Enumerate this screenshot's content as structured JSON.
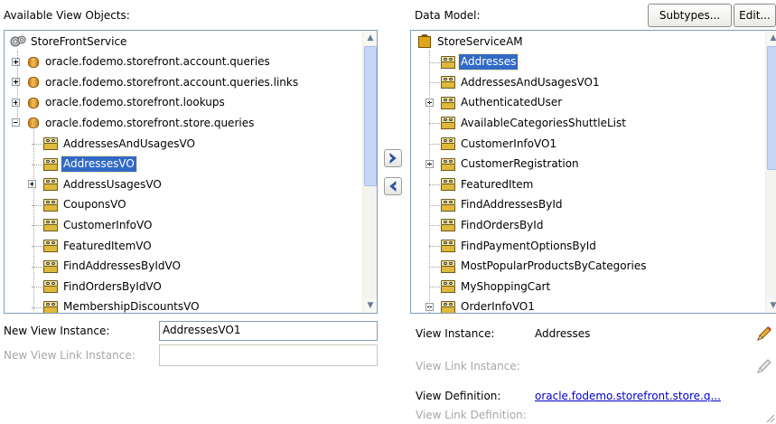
{
  "left": {
    "header": "Available View Objects:",
    "tree": [
      {
        "label": "StoreFrontService",
        "kind": "service",
        "level": 0
      },
      {
        "label": "oracle.fodemo.storefront.account.queries",
        "kind": "package",
        "level": 1,
        "expander": "plus"
      },
      {
        "label": "oracle.fodemo.storefront.account.queries.links",
        "kind": "package",
        "level": 1,
        "expander": "plus"
      },
      {
        "label": "oracle.fodemo.storefront.lookups",
        "kind": "package",
        "level": 1,
        "expander": "plus"
      },
      {
        "label": "oracle.fodemo.storefront.store.queries",
        "kind": "package",
        "level": 1,
        "expander": "minus"
      },
      {
        "label": "AddressesAndUsagesVO",
        "kind": "vo",
        "level": 2
      },
      {
        "label": "AddressesVO",
        "kind": "vo",
        "level": 2,
        "selected": true
      },
      {
        "label": "AddressUsagesVO",
        "kind": "vo",
        "level": 2,
        "expander": "plus"
      },
      {
        "label": "CouponsVO",
        "kind": "vo",
        "level": 2
      },
      {
        "label": "CustomerInfoVO",
        "kind": "vo",
        "level": 2
      },
      {
        "label": "FeaturedItemVO",
        "kind": "vo",
        "level": 2
      },
      {
        "label": "FindAddressesByIdVO",
        "kind": "vo",
        "level": 2
      },
      {
        "label": "FindOrdersByIdVO",
        "kind": "vo",
        "level": 2
      },
      {
        "label": "MembershipDiscountsVO",
        "kind": "vo",
        "level": 2
      }
    ],
    "new_view_instance_label": "New View Instance:",
    "new_view_instance_value": "AddressesVO1",
    "new_view_link_instance_label": "New View Link Instance:",
    "new_view_link_instance_value": ""
  },
  "shuttle": {
    "add_icon": "chevron-right-icon",
    "remove_icon": "chevron-left-icon"
  },
  "right": {
    "header": "Data Model:",
    "subtypes_button": "Subtypes...",
    "edit_button": "Edit...",
    "tree": [
      {
        "label": "StoreServiceAM",
        "kind": "am",
        "level": 0
      },
      {
        "label": "Addresses",
        "kind": "vo",
        "level": 1,
        "selected": true
      },
      {
        "label": "AddressesAndUsagesVO1",
        "kind": "vo",
        "level": 1
      },
      {
        "label": "AuthenticatedUser",
        "kind": "vo",
        "level": 1,
        "expander": "plus"
      },
      {
        "label": "AvailableCategoriesShuttleList",
        "kind": "vo",
        "level": 1
      },
      {
        "label": "CustomerInfoVO1",
        "kind": "vo",
        "level": 1
      },
      {
        "label": "CustomerRegistration",
        "kind": "vo",
        "level": 1,
        "expander": "plus"
      },
      {
        "label": "FeaturedItem",
        "kind": "vo",
        "level": 1
      },
      {
        "label": "FindAddressesById",
        "kind": "vo",
        "level": 1
      },
      {
        "label": "FindOrdersById",
        "kind": "vo",
        "level": 1
      },
      {
        "label": "FindPaymentOptionsById",
        "kind": "vo",
        "level": 1
      },
      {
        "label": "MostPopularProductsByCategories",
        "kind": "vo",
        "level": 1
      },
      {
        "label": "MyShoppingCart",
        "kind": "vo",
        "level": 1
      },
      {
        "label": "OrderInfoVO1",
        "kind": "vo",
        "level": 1,
        "expander": "minus"
      }
    ],
    "view_instance_label": "View Instance:",
    "view_instance_value": "Addresses",
    "view_link_instance_label": "View Link Instance:",
    "view_definition_label": "View Definition:",
    "view_definition_value": "oracle.fodemo.storefront.store.q...",
    "view_link_definition_label": "View Link Definition:",
    "pencil_icon": "pencil-icon"
  },
  "colors": {
    "selection": "#316ac5",
    "border": "#7f9db9",
    "link": "#0000cc",
    "disabled_text": "#a7a7a7"
  }
}
